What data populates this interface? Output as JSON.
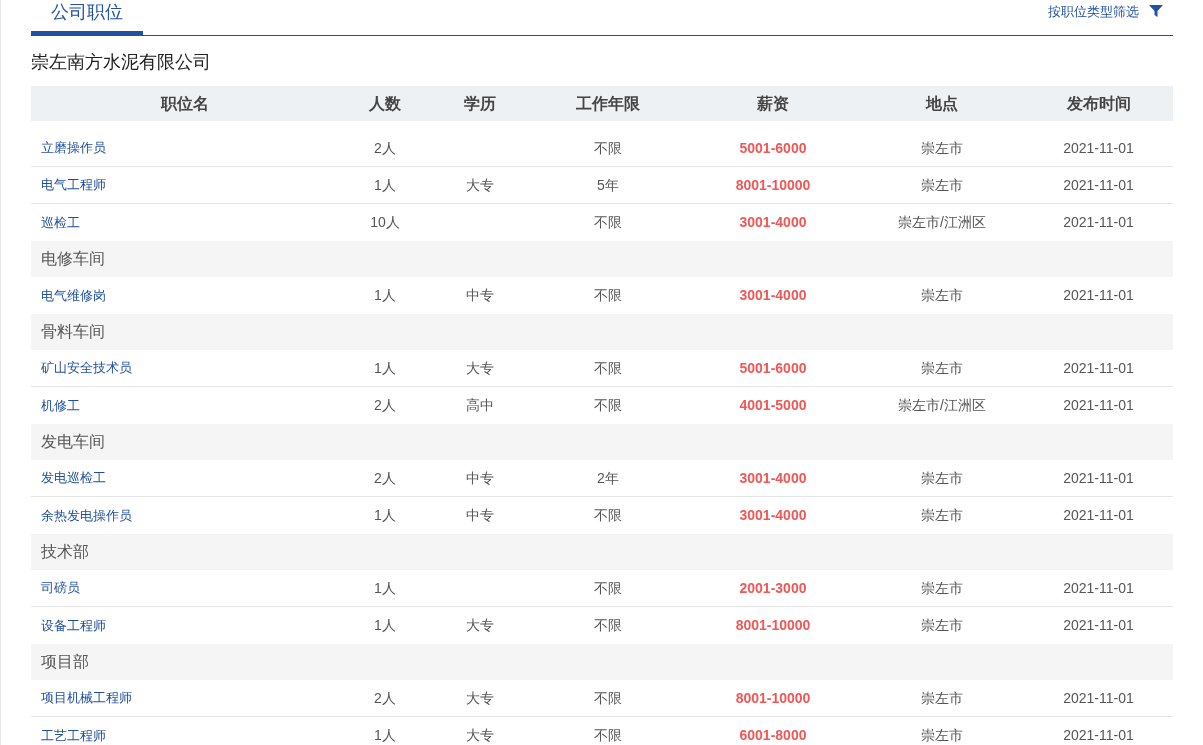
{
  "tabs": [
    {
      "label": "公司职位",
      "selected": true
    }
  ],
  "filter": {
    "label": "按职位类型筛选"
  },
  "company": "崇左南方水泥有限公司",
  "table": {
    "columns": [
      "职位名",
      "人数",
      "学历",
      "工作年限",
      "薪资",
      "地点",
      "发布时间"
    ],
    "rows": [
      {
        "kind": "job",
        "cells": [
          "立磨操作员",
          "2人",
          "",
          "不限",
          "5001-6000",
          "崇左市",
          "2021-11-01"
        ]
      },
      {
        "kind": "job",
        "cells": [
          "电气工程师",
          "1人",
          "大专",
          "5年",
          "8001-10000",
          "崇左市",
          "2021-11-01"
        ]
      },
      {
        "kind": "job",
        "cells": [
          "巡检工",
          "10人",
          "",
          "不限",
          "3001-4000",
          "崇左市/江洲区",
          "2021-11-01"
        ]
      },
      {
        "kind": "group",
        "label": "电修车间"
      },
      {
        "kind": "job",
        "cells": [
          "电气维修岗",
          "1人",
          "中专",
          "不限",
          "3001-4000",
          "崇左市",
          "2021-11-01"
        ]
      },
      {
        "kind": "group",
        "label": "骨料车间"
      },
      {
        "kind": "job",
        "cells": [
          "矿山安全技术员",
          "1人",
          "大专",
          "不限",
          "5001-6000",
          "崇左市",
          "2021-11-01"
        ]
      },
      {
        "kind": "job",
        "cells": [
          "机修工",
          "2人",
          "高中",
          "不限",
          "4001-5000",
          "崇左市/江洲区",
          "2021-11-01"
        ]
      },
      {
        "kind": "group",
        "label": "发电车间"
      },
      {
        "kind": "job",
        "cells": [
          "发电巡检工",
          "2人",
          "中专",
          "2年",
          "3001-4000",
          "崇左市",
          "2021-11-01"
        ]
      },
      {
        "kind": "job",
        "cells": [
          "余热发电操作员",
          "1人",
          "中专",
          "不限",
          "3001-4000",
          "崇左市",
          "2021-11-01"
        ]
      },
      {
        "kind": "group",
        "label": "技术部"
      },
      {
        "kind": "job",
        "cells": [
          "司磅员",
          "1人",
          "",
          "不限",
          "2001-3000",
          "崇左市",
          "2021-11-01"
        ]
      },
      {
        "kind": "job",
        "cells": [
          "设备工程师",
          "1人",
          "大专",
          "不限",
          "8001-10000",
          "崇左市",
          "2021-11-01"
        ]
      },
      {
        "kind": "group",
        "label": "项目部"
      },
      {
        "kind": "job",
        "cells": [
          "项目机械工程师",
          "2人",
          "大专",
          "不限",
          "8001-10000",
          "崇左市",
          "2021-11-01"
        ]
      },
      {
        "kind": "job",
        "cells": [
          "工艺工程师",
          "1人",
          "大专",
          "不限",
          "6001-8000",
          "崇左市",
          "2021-11-01"
        ]
      }
    ]
  }
}
